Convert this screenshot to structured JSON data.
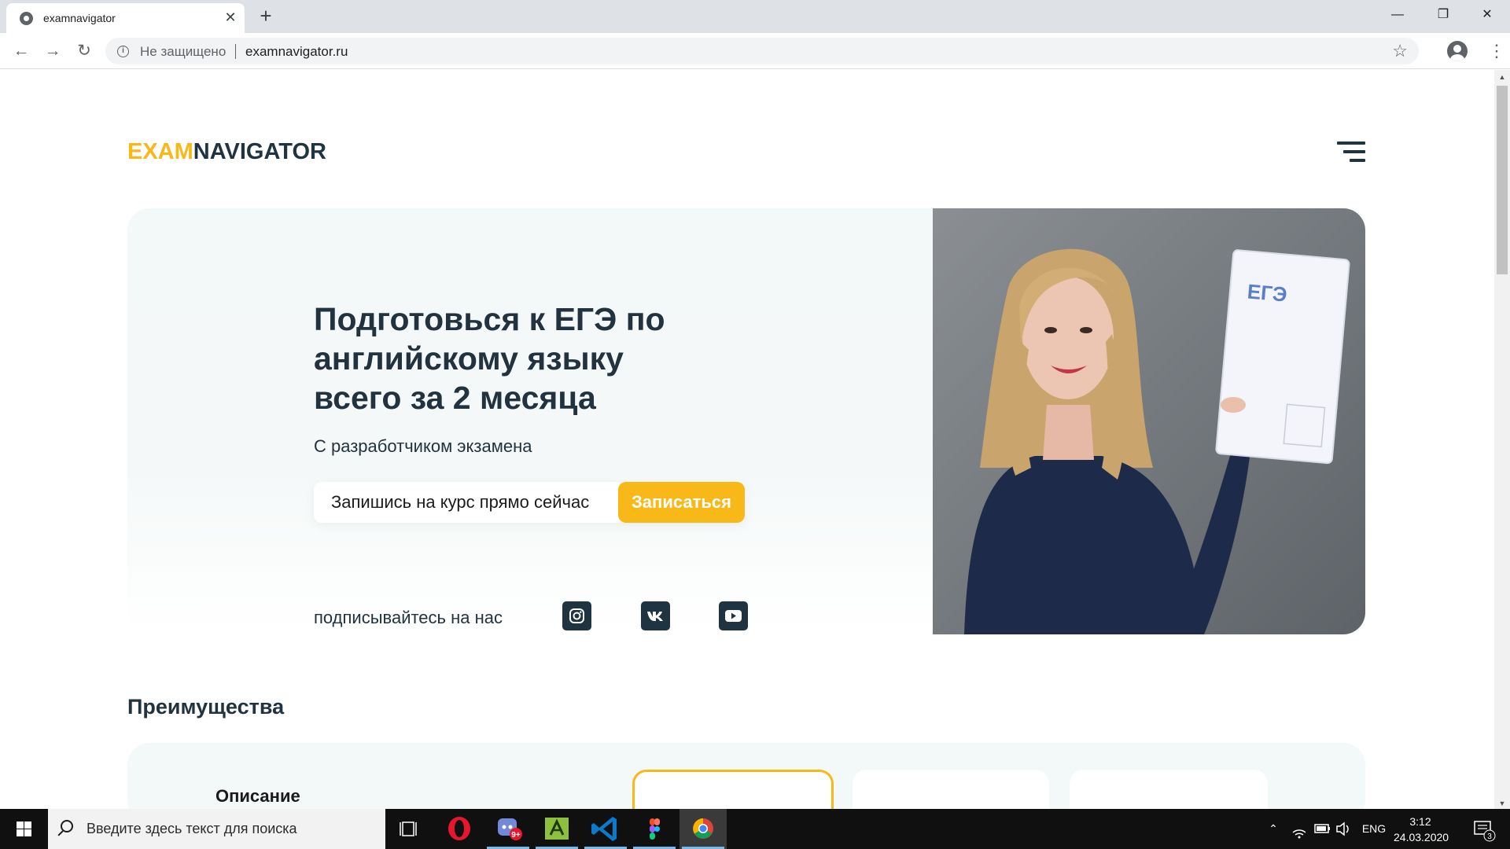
{
  "browser": {
    "tab_title": "examnavigator",
    "tab_close": "✕",
    "new_tab": "+",
    "window": {
      "minimize": "—",
      "maximize": "❐",
      "close": "✕"
    },
    "nav": {
      "back": "←",
      "forward": "→",
      "reload": "↻"
    },
    "security_icon": "i",
    "security_text": "Не защищено",
    "url": "examnavigator.ru",
    "bookmark": "☆",
    "menu": "⋮"
  },
  "site": {
    "logo_part1": "EXAM",
    "logo_part2": "NAVIGATOR",
    "hero": {
      "title": "Подготовься к ЕГЭ по английскому языку всего за 2 месяца",
      "subtitle": "С разработчиком экзамена",
      "signup_placeholder": "Запишись на курс прямо сейчас",
      "signup_button": "Записаться",
      "social_label": "подписывайтесь на нас",
      "social": [
        "instagram-icon",
        "vk-icon",
        "youtube-icon"
      ],
      "photo_label": "ЕГЭ"
    },
    "advantages": {
      "title": "Преимущества",
      "description_label": "Описание"
    },
    "colors": {
      "accent": "#f8b817",
      "dark": "#1f3341",
      "hero_bg": "#f3f8f8"
    }
  },
  "taskbar": {
    "search_placeholder": "Введите здесь текст для поиска",
    "apps": [
      "task-view-icon",
      "opera-icon",
      "discord-icon",
      "translator-icon",
      "vscode-icon",
      "figma-icon",
      "chrome-icon"
    ],
    "discord_badge": "9+",
    "language": "ENG",
    "time": "3:12",
    "date": "24.03.2020",
    "notifications": "3"
  }
}
